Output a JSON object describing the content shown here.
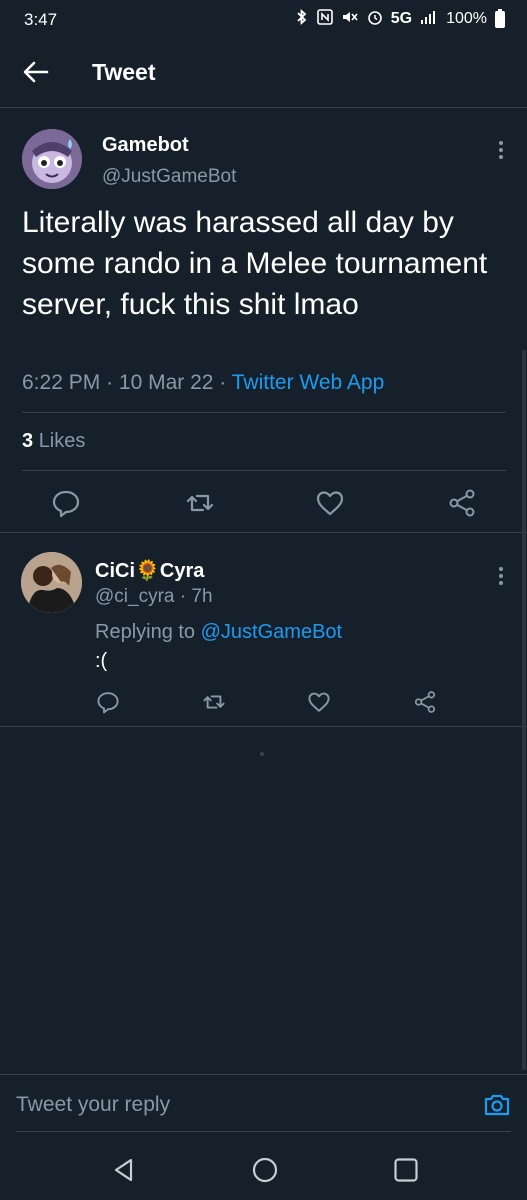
{
  "status_bar": {
    "time": "3:47",
    "network": "5G",
    "battery": "100%",
    "icons": [
      "bluetooth-icon",
      "nfc-icon",
      "mute-icon",
      "alarm-icon",
      "signal-icon",
      "battery-icon"
    ]
  },
  "header": {
    "title": "Tweet"
  },
  "main_tweet": {
    "author_name": "Gamebot",
    "author_handle": "@JustGameBot",
    "text": "Literally was harassed all day by some rando in a Melee tournament server, fuck this shit lmao",
    "time": "6:22 PM",
    "date": "10 Mar 22",
    "source": "Twitter Web App",
    "likes_count": "3",
    "likes_label": "Likes"
  },
  "reply": {
    "author_name": "CiCi🌻Cyra",
    "author_handle": "@ci_cyra",
    "age": "7h",
    "replying_to_label": "Replying to",
    "replying_to_handle": "@JustGameBot",
    "text": ":("
  },
  "composer": {
    "placeholder": "Tweet your reply"
  },
  "colors": {
    "background": "#15202b",
    "border": "#38444d",
    "muted_text": "#8899a6",
    "accent": "#1d9bf0"
  }
}
